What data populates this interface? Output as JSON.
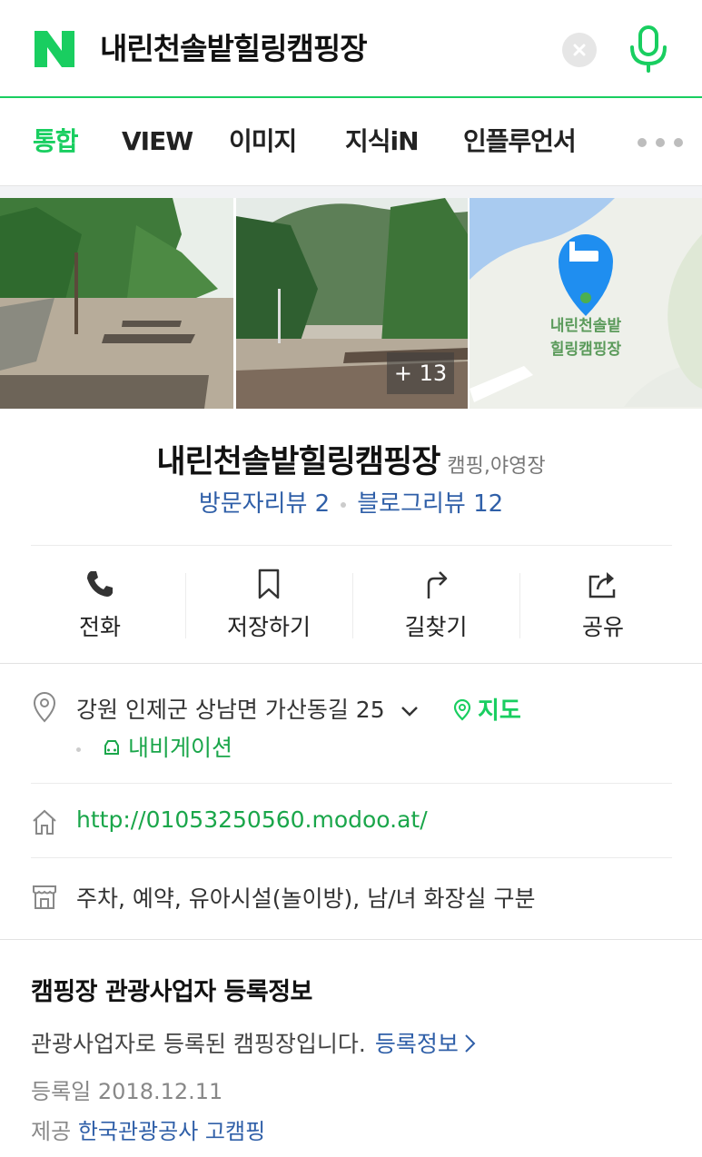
{
  "search": {
    "logo_letter": "N",
    "query": "내린천솔밭힐링캠핑장",
    "clear_icon": "close-icon",
    "mic_icon": "mic-icon"
  },
  "tabs": [
    {
      "label": "통합",
      "active": true
    },
    {
      "label": "VIEW",
      "active": false
    },
    {
      "label": "이미지",
      "active": false
    },
    {
      "label": "지식iN",
      "active": false
    },
    {
      "label": "인플루언서",
      "active": false
    }
  ],
  "photos": {
    "more_count": "+ 13",
    "map_label_line1": "내린천솔밭",
    "map_label_line2": "힐링캠핑장"
  },
  "place": {
    "name": "내린천솔밭힐링캠핑장",
    "category": "캠핑,야영장",
    "visitor_review": "방문자리뷰 2",
    "blog_review": "블로그리뷰 12"
  },
  "actions": [
    {
      "label": "전화",
      "icon": "phone-icon"
    },
    {
      "label": "저장하기",
      "icon": "bookmark-icon"
    },
    {
      "label": "길찾기",
      "icon": "directions-icon"
    },
    {
      "label": "공유",
      "icon": "share-icon"
    }
  ],
  "info": {
    "address": "강원 인제군 상남면 가산동길 25",
    "map_link": "지도",
    "navigation_link": "내비게이션",
    "homepage": "http://01053250560.modoo.at/",
    "facilities": "주차, 예약, 유아시설(놀이방), 남/녀 화장실 구분"
  },
  "registration": {
    "title": "캠핑장 관광사업자 등록정보",
    "description": "관광사업자로 등록된 캠핑장입니다.",
    "link": "등록정보",
    "date_label": "등록일",
    "date": "2018.12.11",
    "provider_label": "제공",
    "provider": "한국관광공사 고캠핑"
  },
  "colors": {
    "naver_green": "#19ce60",
    "link_blue": "#2f5fa8",
    "map_pin_blue": "#1f8ef0"
  }
}
